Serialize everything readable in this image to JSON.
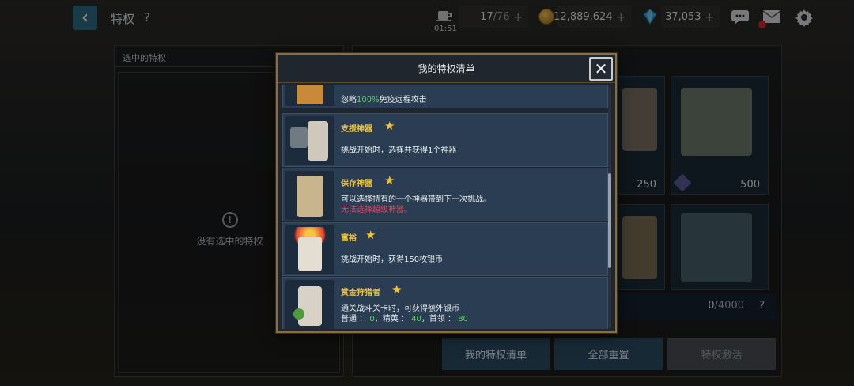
{
  "header": {
    "back_icon": "chevron-left-icon",
    "title": "特权",
    "help": "?",
    "timer": "01:51",
    "stamina": {
      "value": "17",
      "max": "/76",
      "plus": "+"
    },
    "gold": {
      "value": "12,889,624",
      "plus": "+"
    },
    "gems": {
      "value": "37,053",
      "plus": "+"
    }
  },
  "left_panel": {
    "title": "选中的特权",
    "empty_icon": "!",
    "empty_text": "没有选中的特权"
  },
  "right_panel": {
    "cards": [
      {
        "price": ""
      },
      {
        "price": "500"
      },
      {
        "price": "250"
      }
    ],
    "progress": {
      "value": "0",
      "max": "/4000"
    },
    "progress_help": "?",
    "buttons": {
      "my_list": "我的特权清单",
      "reset_all": "全部重置",
      "activate": "特权激活"
    }
  },
  "modal": {
    "title": "我的特权清单",
    "close": "✕",
    "items": [
      {
        "name": "",
        "desc_pre": "忽略",
        "desc_highlight": "100%",
        "desc_post": "免疫远程攻击",
        "warn": ""
      },
      {
        "name": "支援神器",
        "desc": "挑战开始时，选择并获得1个神器",
        "warn": ""
      },
      {
        "name": "保存神器",
        "desc": "可以选择持有的一个神器带到下一次挑战。",
        "warn": "无法选择超级神器。"
      },
      {
        "name": "富裕",
        "desc": "挑战开始时，获得150枚银币",
        "warn": ""
      },
      {
        "name": "赏金狩猎者",
        "desc": "通关战斗关卡时，可获得额外银币",
        "rewards_pre": "普通 ： ",
        "r1": "0",
        "mid1": "，精英 ： ",
        "r2": "40",
        "mid2": "，首领 ： ",
        "r3": "80"
      }
    ]
  },
  "colors": {
    "gold_text": "#f0c23a",
    "warn_red": "#e5465e",
    "value_green": "#5ad15a",
    "modal_border": "#8a6d3f",
    "button_blue": "#2d4b63"
  }
}
